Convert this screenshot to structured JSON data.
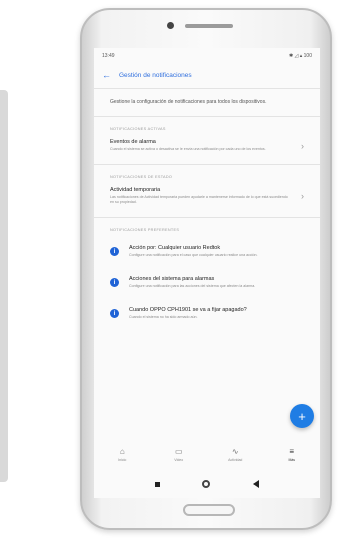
{
  "status_bar": {
    "time": "13:49",
    "icons": "✱ ◿ ▴ 100"
  },
  "app_bar": {
    "title": "Gestión de notificaciones"
  },
  "intro": {
    "text": "Gestione la configuración de notificaciones para todos los dispositivos."
  },
  "sections": {
    "alarm": {
      "header": "NOTIFICACIONES ACTIVAS",
      "title": "Eventos de alarma",
      "desc": "Cuando el sistema se activa o desactiva se le envía una notificación por cada uno de los eventos."
    },
    "temporary": {
      "header": "NOTIFICACIONES DE ESTADO",
      "title": "Actividad temporaria",
      "desc": "Las notificaciones de Actividad temporaria pueden ayudarle a mantenerse informado de lo que está sucediendo en su propiedad."
    },
    "preferences": {
      "header": "NOTIFICACIONES PREFERENTES",
      "items": [
        {
          "title": "Acción por: Cualquier usuario Redtok",
          "desc": "Configure una notificación para el caso que cualquier usuario realice una acción."
        },
        {
          "title": "Acciones del sistema para alarmas",
          "desc": "Configure una notificación para las acciones del sistema que afecten la alarma."
        },
        {
          "title": "Cuando OPPO CPH1901 se va a fijar apagado?",
          "desc": "Cuando el sistema no ha sido armado aún."
        }
      ]
    }
  },
  "fab": {
    "label": "+"
  },
  "bottom_nav": [
    {
      "icon": "home-icon",
      "glyph": "⌂",
      "label": "Inicio"
    },
    {
      "icon": "video-icon",
      "glyph": "▭",
      "label": "Video"
    },
    {
      "icon": "activity-icon",
      "glyph": "∿",
      "label": "Actividad"
    },
    {
      "icon": "menu-icon",
      "glyph": "≡",
      "label": "Más"
    }
  ],
  "colors": {
    "accent": "#2f6fde",
    "fab": "#1f7de4",
    "info": "#1f63d6"
  }
}
